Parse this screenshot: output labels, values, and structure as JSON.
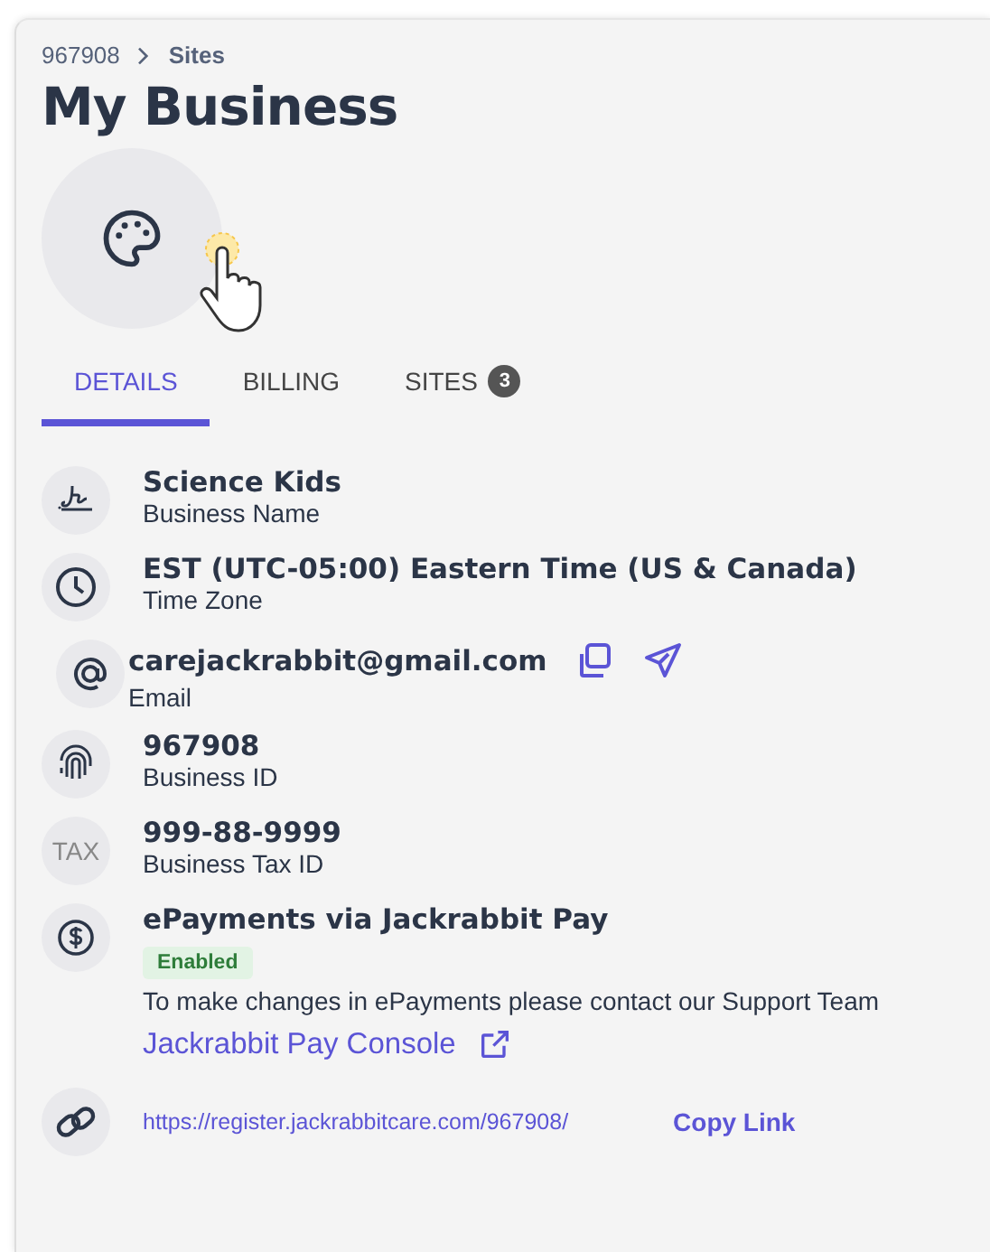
{
  "breadcrumb": [
    {
      "label": "967908"
    },
    {
      "label": "Sites"
    }
  ],
  "title": "My Business",
  "tabs": [
    {
      "label": "DETAILS",
      "selected": true
    },
    {
      "label": "BILLING",
      "selected": false
    },
    {
      "label": "SITES",
      "selected": false,
      "count": "3"
    }
  ],
  "details": [
    {
      "kind": "signature",
      "value": "Science Kids",
      "label": "Business Name"
    },
    {
      "kind": "clock",
      "value": "EST (UTC-05:00) Eastern Time (US & Canada)",
      "label": "Time Zone"
    },
    {
      "kind": "email",
      "value": "carejackrabbit@gmail.com",
      "label": "Email"
    },
    {
      "kind": "fingerprint",
      "value": "967908",
      "label": "Business ID"
    },
    {
      "kind": "tax",
      "icon_text": "TAX",
      "value": "999-88-9999",
      "label": "Business Tax ID"
    }
  ],
  "payments": {
    "title": "ePayments via Jackrabbit Pay",
    "status": "Enabled",
    "note": "To make changes in ePayments please contact our Support Team",
    "console_link": "Jackrabbit Pay Console"
  },
  "registration": {
    "url": "https://register.jackrabbitcare.com/967908/",
    "copy": "Copy Link"
  }
}
